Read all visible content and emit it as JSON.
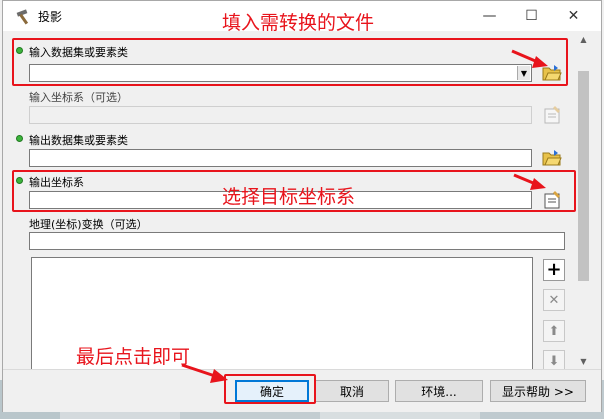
{
  "window": {
    "title": "投影",
    "minimize_glyph": "—",
    "maximize_glyph": "☐",
    "close_glyph": "✕"
  },
  "fields": {
    "input_dataset": {
      "label": "输入数据集或要素类",
      "value": ""
    },
    "input_crs": {
      "label": "输入坐标系（可选）",
      "value": ""
    },
    "output_dataset": {
      "label": "输出数据集或要素类",
      "value": ""
    },
    "output_crs": {
      "label": "输出坐标系",
      "value": ""
    },
    "geo_transform": {
      "label": "地理(坐标)变换（可选）",
      "value": ""
    }
  },
  "list_controls": {
    "add_glyph": "+",
    "remove_glyph": "✕",
    "up_glyph": "⬆",
    "down_glyph": "⬇"
  },
  "buttons": {
    "ok": "确定",
    "cancel": "取消",
    "environments": "环境...",
    "show_help": "显示帮助 >>"
  },
  "annotations": {
    "top": "填入需转换的文件",
    "middle": "选择目标坐标系",
    "bottom": "最后点击即可"
  },
  "colors": {
    "annotation_red": "#e8141c",
    "required_dot_green": "#3cb43c"
  }
}
